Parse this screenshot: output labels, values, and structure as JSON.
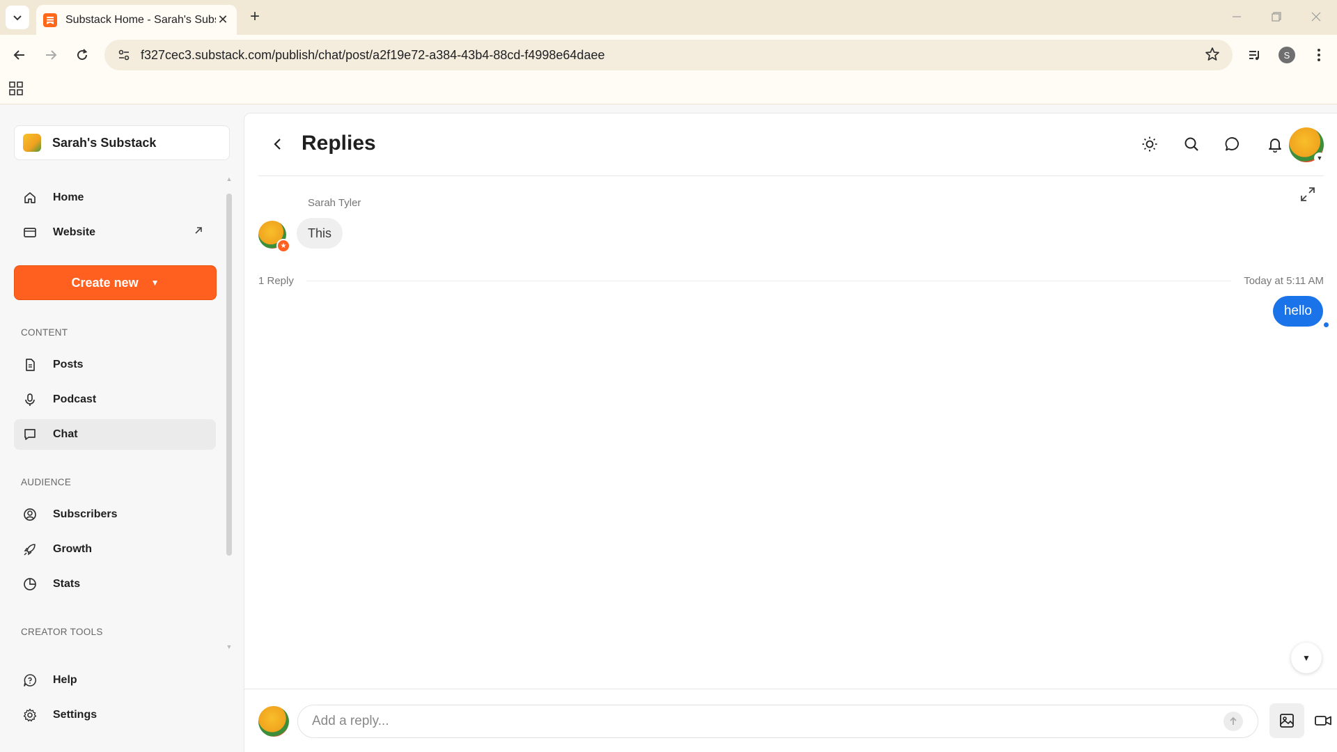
{
  "browser": {
    "tab_title": "Substack Home - Sarah's Substack",
    "url": "f327cec3.substack.com/publish/chat/post/a2f19e72-a384-43b4-88cd-f4998e64daee",
    "profile_initial": "S"
  },
  "sidebar": {
    "publication_name": "Sarah's Substack",
    "top_items": [
      {
        "label": "Home",
        "icon": "home-icon"
      },
      {
        "label": "Website",
        "icon": "website-icon"
      }
    ],
    "create_label": "Create new",
    "sections": [
      {
        "heading": "CONTENT",
        "items": [
          {
            "label": "Posts",
            "icon": "document-icon"
          },
          {
            "label": "Podcast",
            "icon": "microphone-icon"
          },
          {
            "label": "Chat",
            "icon": "chat-icon",
            "active": true
          }
        ]
      },
      {
        "heading": "AUDIENCE",
        "items": [
          {
            "label": "Subscribers",
            "icon": "user-circle-icon"
          },
          {
            "label": "Growth",
            "icon": "rocket-icon"
          },
          {
            "label": "Stats",
            "icon": "pie-chart-icon"
          }
        ]
      },
      {
        "heading": "CREATOR TOOLS",
        "items": []
      }
    ],
    "bottom_items": [
      {
        "label": "Help",
        "icon": "help-icon"
      },
      {
        "label": "Settings",
        "icon": "gear-icon"
      }
    ]
  },
  "main": {
    "title": "Replies",
    "thread": {
      "author": "Sarah Tyler",
      "message": "This",
      "reply_count": "1 Reply",
      "reply_time": "Today at 5:11 AM",
      "my_reply": "hello"
    },
    "composer": {
      "placeholder": "Add a reply..."
    }
  },
  "colors": {
    "accent": "#ff5f1f",
    "bubble_blue": "#1a73e8"
  }
}
